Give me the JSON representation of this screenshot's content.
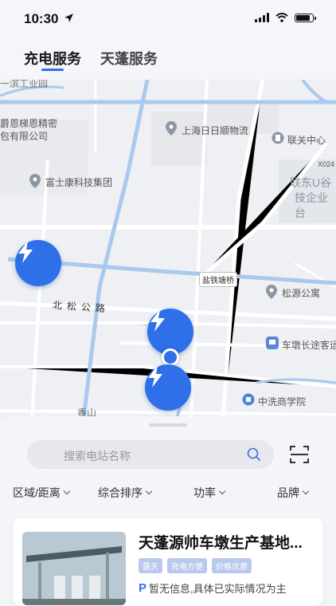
{
  "status_bar": {
    "time": "10:30"
  },
  "tabs": [
    {
      "label": "充电服务",
      "active": true
    },
    {
      "label": "天蓬服务",
      "active": false
    }
  ],
  "map": {
    "pois": [
      {
        "name": "上海日日顺物流"
      },
      {
        "name": "联关中心"
      },
      {
        "name": "富士康科技集团"
      },
      {
        "name": "松源公寓"
      },
      {
        "name": "车墩长途客运"
      },
      {
        "name": "中洗商学院"
      }
    ],
    "labels": {
      "top_left_partial": "一滨工业园",
      "company_line1": "爵恩梯恩精密",
      "company_line2": "包有限公司",
      "east_line1": "联东U谷",
      "east_line2": "技企业台",
      "road_north_song": "北松公路",
      "bridge": "盐铁塘桥",
      "road_code": "X024",
      "bottom_partial": "香山"
    },
    "charger_count": 3
  },
  "sheet": {
    "search_placeholder": "搜索电站名称",
    "filters": [
      "区域/距离",
      "综合排序",
      "功率",
      "品牌"
    ],
    "station": {
      "name": "天蓬源帅车墩生产基地...",
      "tags": [
        "露天",
        "充电方便",
        "价格优惠"
      ],
      "info_icon": "P",
      "info": "暂无信息,具体已实际情况为主"
    }
  },
  "colors": {
    "accent": "#2f6fe8",
    "road_blue": "#a9c9ee",
    "map_bg": "#eef0f3"
  },
  "icons": [
    "location-arrow-icon",
    "signal-icon",
    "wifi-icon",
    "battery-icon",
    "lightning-icon",
    "search-icon",
    "scan-icon",
    "chevron-down-icon",
    "map-pin-icon"
  ]
}
